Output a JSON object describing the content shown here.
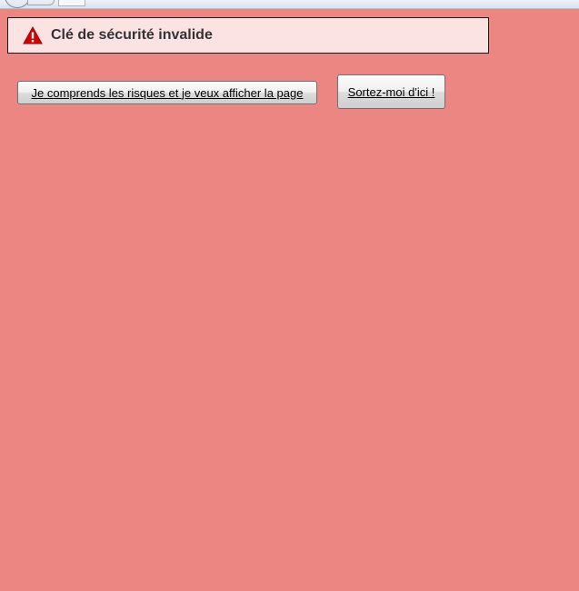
{
  "error": {
    "title": "Clé de sécurité invalide",
    "icon": "warning-icon",
    "icon_color": "#d40000"
  },
  "actions": {
    "accept_risk_label": "Je comprends les risques et je veux afficher la page",
    "leave_label": "Sortez-moi d'ici !"
  },
  "colors": {
    "page_background": "#ec8683",
    "banner_background": "#fbe3e3"
  }
}
